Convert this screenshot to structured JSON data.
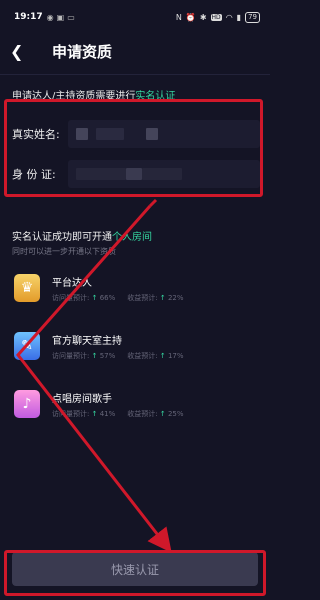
{
  "status_bar": {
    "time": "19:17",
    "battery": "79",
    "left_icons": [
      "notification-icon",
      "image-icon",
      "message-icon"
    ],
    "right_icons": [
      "mute-icon",
      "alarm-icon",
      "bluetooth-icon",
      "hd-icon",
      "wifi-icon",
      "signal-icon",
      "battery-icon"
    ]
  },
  "header": {
    "back_icon": "chevron-left-icon",
    "title": "申请资质"
  },
  "intro": {
    "text": "申请达人/主持资质需要进行",
    "accent_text": "实名认证",
    "accent_color": "#35d6a0"
  },
  "form": {
    "name_label": "真实姓名:",
    "id_label": "身 份 证:"
  },
  "benefits": {
    "title_text": "实名认证成功即可开通",
    "title_accent": "个人房间",
    "subtitle": "同时可以进一步开通以下资质",
    "visit_label": "访问量预计:",
    "income_label": "收益预计:",
    "items": [
      {
        "name": "平台达人",
        "visit": "66%",
        "income": "22%",
        "badge_color": "#f0b440"
      },
      {
        "name": "官方聊天室主持",
        "visit": "57%",
        "income": "17%",
        "badge_color": "#4a8df0"
      },
      {
        "name": "点唱房间歌手",
        "visit": "41%",
        "income": "25%",
        "badge_color": "#e07ae8"
      }
    ]
  },
  "submit_button": {
    "label": "快速认证"
  },
  "annotation_color": "#d0182a"
}
